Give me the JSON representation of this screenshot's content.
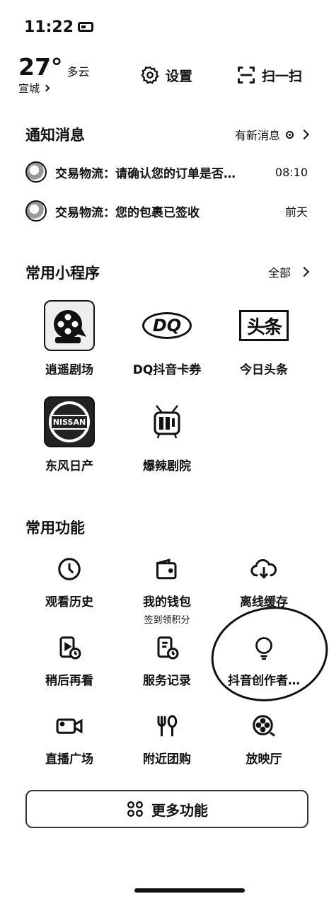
{
  "status_bar": {
    "time": "11:22"
  },
  "weather": {
    "temperature": "27°",
    "condition": "多云",
    "city": "宣城"
  },
  "top_actions": {
    "settings_label": "设置",
    "scan_label": "扫一扫"
  },
  "notifications": {
    "title": "通知消息",
    "more_label": "有新消息",
    "items": [
      {
        "text": "交易物流：请确认您的订单是否…",
        "time": "08:10"
      },
      {
        "text": "交易物流：您的包裹已签收",
        "time": "前天"
      }
    ]
  },
  "mini_programs": {
    "title": "常用小程序",
    "more_label": "全部",
    "items": [
      {
        "label": "逍遥剧场",
        "icon": "film-reel-icon"
      },
      {
        "label": "DQ抖音卡券",
        "icon": "dq-logo-icon"
      },
      {
        "label": "今日头条",
        "icon": "toutiao-logo-icon"
      },
      {
        "label": "东风日产",
        "icon": "nissan-logo-icon"
      },
      {
        "label": "爆辣剧院",
        "icon": "tv-icon"
      }
    ],
    "logo_texts": {
      "dq": "DQ",
      "toutiao": "头条",
      "nissan": "NISSAN"
    }
  },
  "functions": {
    "title": "常用功能",
    "items": [
      {
        "label": "观看历史",
        "icon": "clock-icon"
      },
      {
        "label": "我的钱包",
        "icon": "wallet-icon",
        "sub": "签到领积分"
      },
      {
        "label": "离线缓存",
        "icon": "cloud-download-icon"
      },
      {
        "label": "稍后再看",
        "icon": "watch-later-icon"
      },
      {
        "label": "服务记录",
        "icon": "service-record-icon"
      },
      {
        "label": "抖音创作者…",
        "icon": "lightbulb-icon"
      },
      {
        "label": "直播广场",
        "icon": "camera-icon"
      },
      {
        "label": "附近团购",
        "icon": "fork-knife-icon"
      },
      {
        "label": "放映厅",
        "icon": "film-reel-icon"
      }
    ]
  },
  "more_button": {
    "label": "更多功能",
    "icon": "grid-icon"
  }
}
